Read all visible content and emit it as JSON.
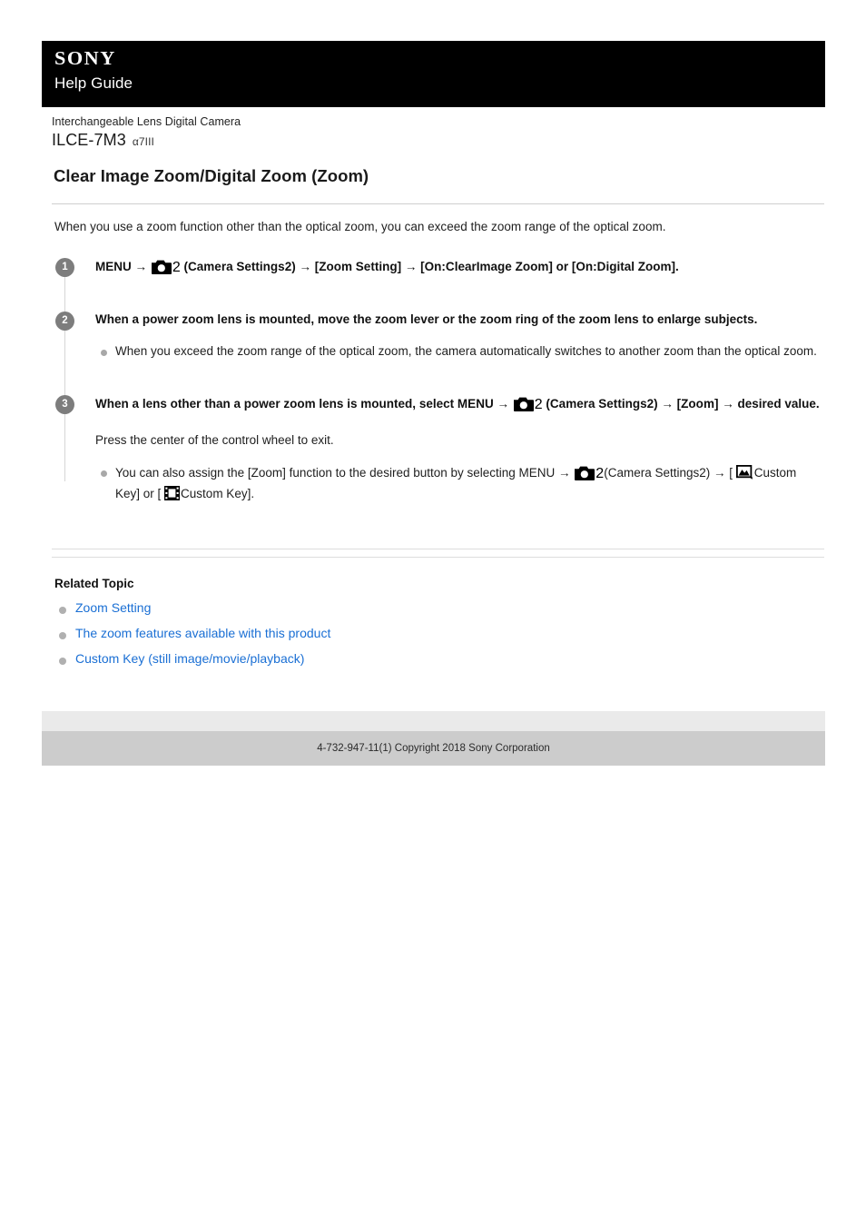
{
  "header": {
    "brand": "SONY",
    "site_title": "Help Guide"
  },
  "product": {
    "category": "Interchangeable Lens Digital Camera",
    "model": "ILCE-7M3",
    "alias": "α7III"
  },
  "page": {
    "title": "Clear Image Zoom/Digital Zoom (Zoom)",
    "intro": "When you use a zoom function other than the optical zoom, you can exceed the zoom range of the optical zoom."
  },
  "steps": [
    {
      "number": "1",
      "text_before_icon": "MENU →",
      "icon": "camera-settings-icon",
      "icon_number": "2",
      "text_after_icon": "(Camera Settings2) → [Zoom Setting] → [On:ClearImage Zoom] or [On:Digital Zoom].",
      "bullets": []
    },
    {
      "number": "2",
      "text": "When a power zoom lens is mounted, move the zoom lever or the zoom ring of the zoom lens to enlarge subjects.",
      "bullets": [
        "When you exceed the zoom range of the optical zoom, the camera automatically switches to another zoom than the optical zoom."
      ]
    },
    {
      "number": "3",
      "text_before_icon": "When a lens other than a power zoom lens is mounted, select MENU →",
      "icon": "camera-settings-icon",
      "icon_number": "2",
      "text_after_icon": "(Camera Settings2) → [Zoom] → desired value.",
      "note": "Press the center of the control wheel to exit.",
      "bullet_parts": {
        "before_icon": "You can also assign the [Zoom] function to the desired button by selecting MENU →",
        "icon": "camera-settings-icon",
        "icon_number": "2",
        "after_icon": "(Camera Settings2) → [",
        "still_icon": "still-image-icon",
        "middle": "Custom Key] or [",
        "movie_icon": "movie-icon",
        "end": "Custom Key]."
      }
    }
  ],
  "related": {
    "heading": "Related Topic",
    "links": [
      "Zoom Setting",
      "The zoom features available with this product",
      "Custom Key (still image/movie/playback)"
    ]
  },
  "footer": {
    "copyright": "4-732-947-11(1) Copyright 2018 Sony Corporation"
  },
  "colors": {
    "link": "#1a6fd4",
    "header_bg": "#000000",
    "step_circle": "#7d7d7d",
    "footer_top": "#eaeaea",
    "footer_bottom": "#cccccc"
  }
}
